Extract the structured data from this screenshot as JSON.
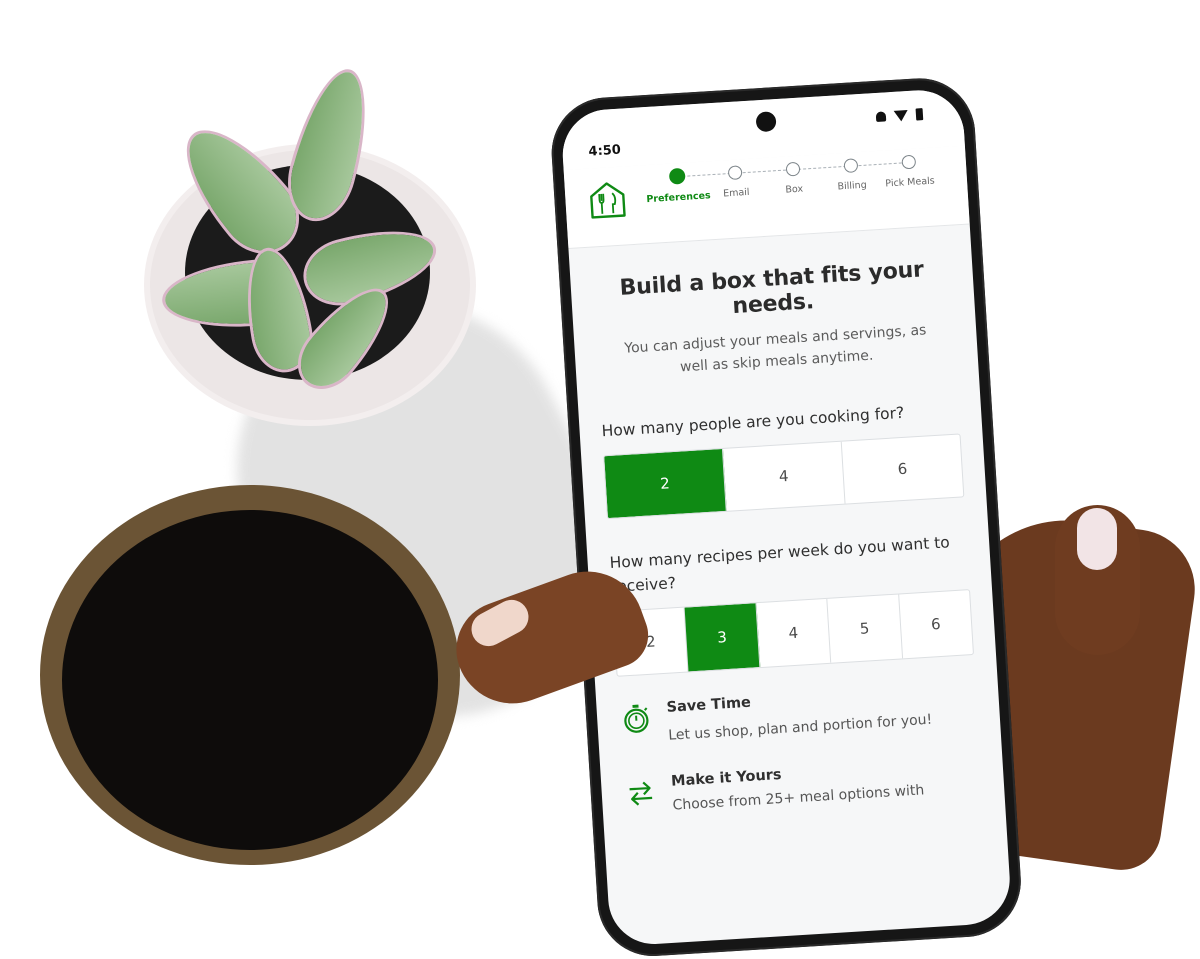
{
  "status": {
    "time": "4:50"
  },
  "steps": [
    {
      "label": "Preferences",
      "active": true
    },
    {
      "label": "Email",
      "active": false
    },
    {
      "label": "Box",
      "active": false
    },
    {
      "label": "Billing",
      "active": false
    },
    {
      "label": "Pick Meals",
      "active": false
    }
  ],
  "main": {
    "title": "Build a box that fits your needs.",
    "subtitle": "You can adjust your meals and servings, as well as skip meals anytime.",
    "people_question": "How many people are you cooking for?",
    "people_options": [
      "2",
      "4",
      "6"
    ],
    "people_selected": "2",
    "recipes_question": "How many recipes per week do you want to receive?",
    "recipes_options": [
      "2",
      "3",
      "4",
      "5",
      "6"
    ],
    "recipes_selected": "3"
  },
  "features": [
    {
      "icon": "stopwatch-icon",
      "title": "Save Time",
      "desc": "Let us shop, plan and portion for you!"
    },
    {
      "icon": "swap-arrows-icon",
      "title": "Make it Yours",
      "desc": "Choose from 25+ meal options with"
    }
  ],
  "colors": {
    "accent": "#0f8a14",
    "page_bg": "#f6f7f8"
  }
}
